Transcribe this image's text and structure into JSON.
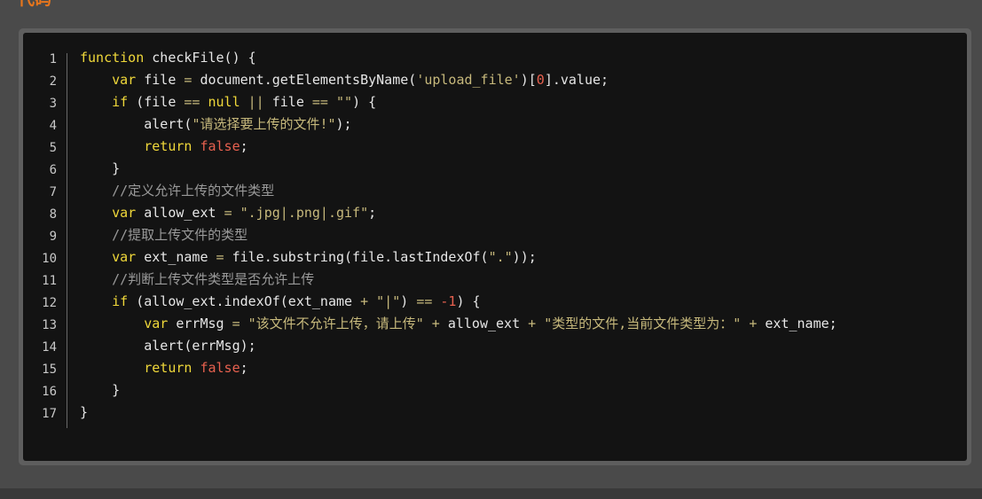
{
  "section": {
    "title": "代码"
  },
  "colors": {
    "page_background": "#4a4a4a",
    "title": "#e8761c",
    "frame": "#5e5e5e",
    "code_background": "#131313",
    "keyword": "#f0d83a",
    "string": "#c7b97c",
    "number": "#e8614f",
    "comment": "#9a9a9a",
    "plain": "#e6e6e6"
  },
  "code": {
    "language": "javascript",
    "lines": [
      {
        "number": "1",
        "tokens": [
          {
            "t": "function",
            "c": "kw"
          },
          {
            "t": " checkFile() {",
            "c": "pl"
          }
        ]
      },
      {
        "number": "2",
        "tokens": [
          {
            "t": "    ",
            "c": "pl"
          },
          {
            "t": "var",
            "c": "kw"
          },
          {
            "t": " file ",
            "c": "pl"
          },
          {
            "t": "=",
            "c": "op"
          },
          {
            "t": " document.getElementsByName(",
            "c": "pl"
          },
          {
            "t": "'upload_file'",
            "c": "str"
          },
          {
            "t": ")[",
            "c": "pl"
          },
          {
            "t": "0",
            "c": "num"
          },
          {
            "t": "].value;",
            "c": "pl"
          }
        ]
      },
      {
        "number": "3",
        "tokens": [
          {
            "t": "    ",
            "c": "pl"
          },
          {
            "t": "if",
            "c": "kw"
          },
          {
            "t": " (file ",
            "c": "pl"
          },
          {
            "t": "==",
            "c": "op"
          },
          {
            "t": " ",
            "c": "pl"
          },
          {
            "t": "null",
            "c": "kw"
          },
          {
            "t": " ",
            "c": "pl"
          },
          {
            "t": "||",
            "c": "op"
          },
          {
            "t": " file ",
            "c": "pl"
          },
          {
            "t": "==",
            "c": "op"
          },
          {
            "t": " ",
            "c": "pl"
          },
          {
            "t": "\"\"",
            "c": "str"
          },
          {
            "t": ") {",
            "c": "pl"
          }
        ]
      },
      {
        "number": "4",
        "tokens": [
          {
            "t": "        alert(",
            "c": "pl"
          },
          {
            "t": "\"请选择要上传的文件!\"",
            "c": "str"
          },
          {
            "t": ");",
            "c": "pl"
          }
        ]
      },
      {
        "number": "5",
        "tokens": [
          {
            "t": "        ",
            "c": "pl"
          },
          {
            "t": "return",
            "c": "kw"
          },
          {
            "t": " ",
            "c": "pl"
          },
          {
            "t": "false",
            "c": "bool"
          },
          {
            "t": ";",
            "c": "pl"
          }
        ]
      },
      {
        "number": "6",
        "tokens": [
          {
            "t": "    }",
            "c": "pl"
          }
        ]
      },
      {
        "number": "7",
        "tokens": [
          {
            "t": "    ",
            "c": "pl"
          },
          {
            "t": "//定义允许上传的文件类型",
            "c": "com"
          }
        ]
      },
      {
        "number": "8",
        "tokens": [
          {
            "t": "    ",
            "c": "pl"
          },
          {
            "t": "var",
            "c": "kw"
          },
          {
            "t": " allow_ext ",
            "c": "pl"
          },
          {
            "t": "=",
            "c": "op"
          },
          {
            "t": " ",
            "c": "pl"
          },
          {
            "t": "\".jpg|.png|.gif\"",
            "c": "str"
          },
          {
            "t": ";",
            "c": "pl"
          }
        ]
      },
      {
        "number": "9",
        "tokens": [
          {
            "t": "    ",
            "c": "pl"
          },
          {
            "t": "//提取上传文件的类型",
            "c": "com"
          }
        ]
      },
      {
        "number": "10",
        "tokens": [
          {
            "t": "    ",
            "c": "pl"
          },
          {
            "t": "var",
            "c": "kw"
          },
          {
            "t": " ext_name ",
            "c": "pl"
          },
          {
            "t": "=",
            "c": "op"
          },
          {
            "t": " file.substring(file.lastIndexOf(",
            "c": "pl"
          },
          {
            "t": "\".\"",
            "c": "str"
          },
          {
            "t": "));",
            "c": "pl"
          }
        ]
      },
      {
        "number": "11",
        "tokens": [
          {
            "t": "    ",
            "c": "pl"
          },
          {
            "t": "//判断上传文件类型是否允许上传",
            "c": "com"
          }
        ]
      },
      {
        "number": "12",
        "tokens": [
          {
            "t": "    ",
            "c": "pl"
          },
          {
            "t": "if",
            "c": "kw"
          },
          {
            "t": " (allow_ext.indexOf(ext_name ",
            "c": "pl"
          },
          {
            "t": "+",
            "c": "op"
          },
          {
            "t": " ",
            "c": "pl"
          },
          {
            "t": "\"|\"",
            "c": "str"
          },
          {
            "t": ") ",
            "c": "pl"
          },
          {
            "t": "==",
            "c": "op"
          },
          {
            "t": " ",
            "c": "pl"
          },
          {
            "t": "-1",
            "c": "num"
          },
          {
            "t": ") {",
            "c": "pl"
          }
        ]
      },
      {
        "number": "13",
        "tokens": [
          {
            "t": "        ",
            "c": "pl"
          },
          {
            "t": "var",
            "c": "kw"
          },
          {
            "t": " errMsg ",
            "c": "pl"
          },
          {
            "t": "=",
            "c": "op"
          },
          {
            "t": " ",
            "c": "pl"
          },
          {
            "t": "\"该文件不允许上传，请上传\"",
            "c": "str"
          },
          {
            "t": " ",
            "c": "pl"
          },
          {
            "t": "+",
            "c": "op"
          },
          {
            "t": " allow_ext ",
            "c": "pl"
          },
          {
            "t": "+",
            "c": "op"
          },
          {
            "t": " ",
            "c": "pl"
          },
          {
            "t": "\"类型的文件,当前文件类型为：\"",
            "c": "str"
          },
          {
            "t": " ",
            "c": "pl"
          },
          {
            "t": "+",
            "c": "op"
          },
          {
            "t": " ext_name;",
            "c": "pl"
          }
        ]
      },
      {
        "number": "14",
        "tokens": [
          {
            "t": "        alert(errMsg);",
            "c": "pl"
          }
        ]
      },
      {
        "number": "15",
        "tokens": [
          {
            "t": "        ",
            "c": "pl"
          },
          {
            "t": "return",
            "c": "kw"
          },
          {
            "t": " ",
            "c": "pl"
          },
          {
            "t": "false",
            "c": "bool"
          },
          {
            "t": ";",
            "c": "pl"
          }
        ]
      },
      {
        "number": "16",
        "tokens": [
          {
            "t": "    }",
            "c": "pl"
          }
        ]
      },
      {
        "number": "17",
        "tokens": [
          {
            "t": "}",
            "c": "pl"
          }
        ]
      }
    ]
  }
}
